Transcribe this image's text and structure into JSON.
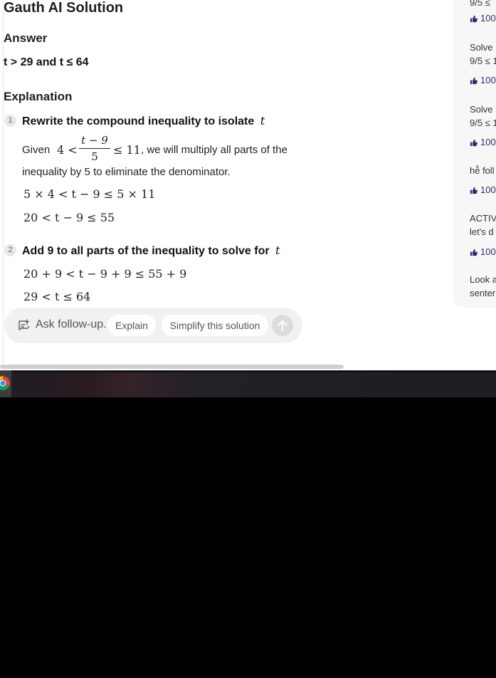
{
  "title": "Gauth AI Solution",
  "answer": {
    "heading": "Answer",
    "text": "t > 29 and t ≤ 64"
  },
  "explanation": {
    "heading": "Explanation",
    "steps": [
      {
        "number": "1",
        "title": "Rewrite the compound inequality to isolate",
        "variable": "t",
        "given_prefix": "Given",
        "frac_lhs": "4 <",
        "frac_num": "t − 9",
        "frac_den": "5",
        "frac_rhs": "≤ 11",
        "given_suffix": ", we will multiply all parts of the",
        "given_line2": "inequality by 5 to eliminate the denominator.",
        "eq1": "5 × 4 < t − 9 ≤ 5 × 11",
        "eq2": "20 < t − 9 ≤ 55"
      },
      {
        "number": "2",
        "title": "Add 9 to all parts of the inequality to solve for",
        "variable": "t",
        "eq1": "20 + 9 < t − 9 + 9 ≤ 55 + 9",
        "eq2": "29 < t ≤ 64"
      }
    ]
  },
  "follow_up": {
    "placeholder": "Ask follow-up.",
    "chips": [
      "Explain",
      "Simplify this solution"
    ]
  },
  "related": [
    {
      "text_lines": [
        "9/5 ≤"
      ],
      "likes": "100"
    },
    {
      "text_lines": [
        "Solve",
        "9/5 ≤ 1"
      ],
      "likes": "100"
    },
    {
      "text_lines": [
        "Solve",
        "9/5 ≤ 1"
      ],
      "likes": "100"
    },
    {
      "text_lines": [
        "hễ foll"
      ],
      "likes": "100"
    },
    {
      "text_lines": [
        "ACTIV",
        "let's d"
      ],
      "likes": "100"
    },
    {
      "text_lines": [
        "Look a",
        "senter"
      ],
      "likes": ""
    }
  ],
  "colors": {
    "like_icon": "#2b2f6b",
    "chip_bg": "#ffffff",
    "bar_bg": "#f1f1f1",
    "chrome_red": "#db4437",
    "chrome_yellow": "#f4b400",
    "chrome_green": "#0f9d58",
    "chrome_blue": "#4285f4"
  },
  "icons": {
    "follow_up": "chat-plus-icon",
    "send": "arrow-up-icon",
    "like": "thumbs-up-icon",
    "taskbar_app": "chrome-icon"
  }
}
